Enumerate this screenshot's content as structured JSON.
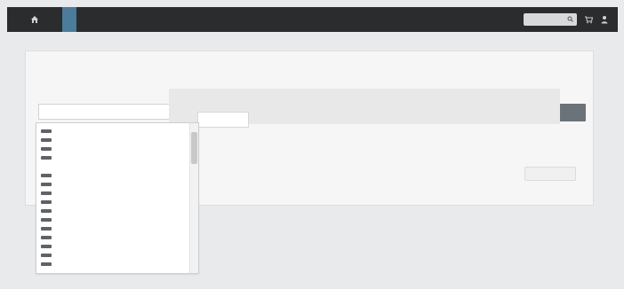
{
  "topbar": {
    "logo_text": "",
    "nav": [
      {
        "label": "",
        "active": false
      },
      {
        "label": "",
        "active": true
      },
      {
        "label": "",
        "active": false
      },
      {
        "label": "",
        "active": false
      },
      {
        "label": "",
        "active": false
      },
      {
        "label": "",
        "active": false
      },
      {
        "label": "",
        "active": false
      }
    ],
    "search_placeholder": "",
    "icons": {
      "home": "home-icon",
      "search": "search-icon",
      "cart": "cart-icon",
      "user": "user-icon"
    }
  },
  "form": {
    "title": "",
    "subtitle": "",
    "labels": {
      "width": "",
      "name": "",
      "quantity": ""
    },
    "inputs": {
      "width_value": "",
      "name_placeholder": "",
      "quantity_placeholder": ""
    },
    "submit_label": ""
  },
  "dropdown": {
    "items": [
      {
        "label": "",
        "swatch": true
      },
      {
        "label": "",
        "swatch": true
      },
      {
        "label": "",
        "swatch": true
      },
      {
        "label": "",
        "swatch": true
      },
      {
        "label": "",
        "swatch": false
      },
      {
        "label": "",
        "swatch": true
      },
      {
        "label": "",
        "swatch": true
      },
      {
        "label": "",
        "swatch": true
      },
      {
        "label": "",
        "swatch": true
      },
      {
        "label": "",
        "swatch": true
      },
      {
        "label": "",
        "swatch": true
      },
      {
        "label": "",
        "swatch": true
      },
      {
        "label": "",
        "swatch": true
      },
      {
        "label": "",
        "swatch": true
      },
      {
        "label": "",
        "swatch": true
      },
      {
        "label": "",
        "swatch": true
      }
    ]
  },
  "secondary": {
    "button_label": ""
  },
  "footer": {
    "text": ""
  },
  "colors": {
    "topbar": "#2b2c2e",
    "active_nav": "#4b7c9a",
    "primary_button": "#6b7379"
  }
}
